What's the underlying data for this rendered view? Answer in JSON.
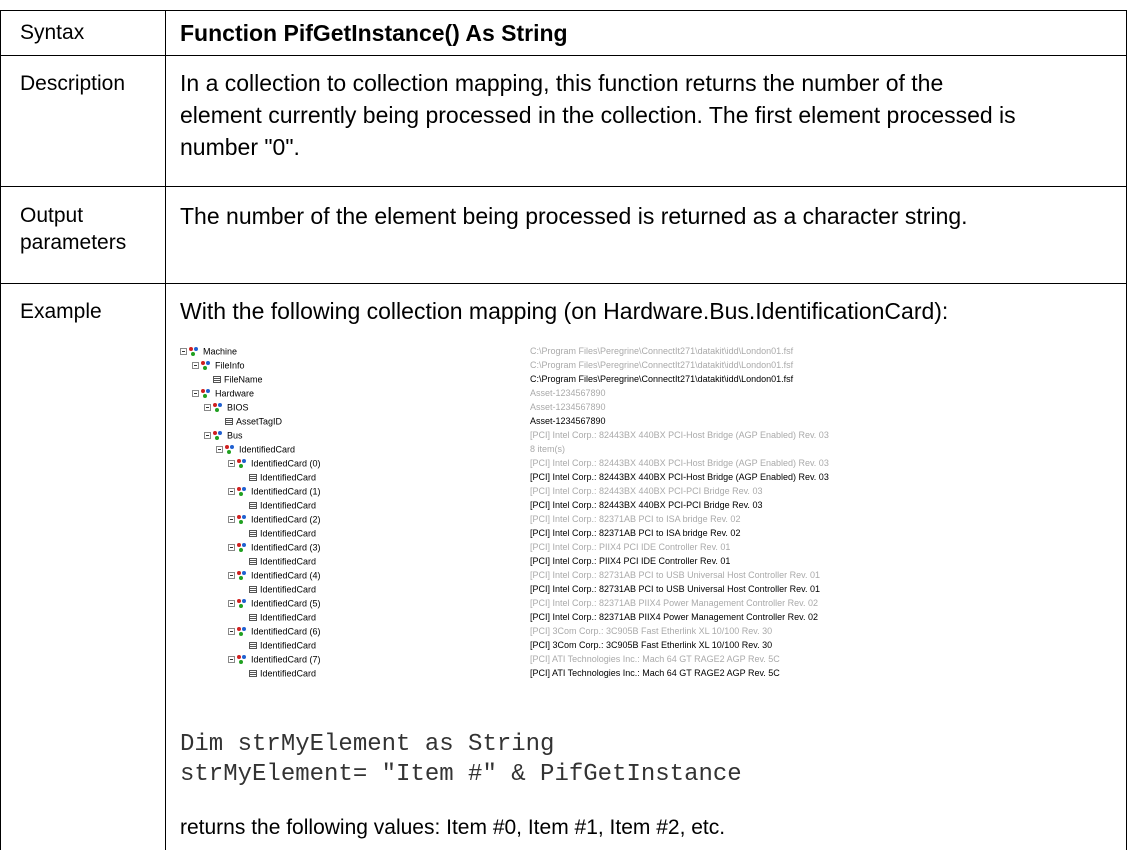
{
  "rows": {
    "syntax": {
      "label": "Syntax",
      "value": "Function PifGetInstance() As String"
    },
    "description": {
      "label": "Description",
      "lines": [
        "In a collection to collection mapping, this function returns the number of the",
        "element currently being processed in the collection. The first element processed is",
        "number \"0\"."
      ]
    },
    "output": {
      "label_lines": [
        "Output",
        "parameters"
      ],
      "value": "The number of the element being processed is returned as a character string."
    },
    "example": {
      "label": "Example",
      "intro": "With the following collection mapping (on Hardware.Bus.IdentificationCard):",
      "code_lines": [
        "Dim strMyElement as String",
        "strMyElement= \"Item #\" & PifGetInstance"
      ],
      "result": "returns the following values: Item #0, Item #1, Item #2, etc."
    }
  },
  "tree": [
    {
      "depth": 0,
      "icon": "collection",
      "label": "Machine",
      "value": "C:\\Program Files\\Peregrine\\ConnectIt271\\datakit\\idd\\London01.fsf",
      "dim": true
    },
    {
      "depth": 1,
      "icon": "collection",
      "label": "FileInfo",
      "value": "C:\\Program Files\\Peregrine\\ConnectIt271\\datakit\\idd\\London01.fsf",
      "dim": true
    },
    {
      "depth": 2,
      "icon": "field",
      "label": "FileName",
      "value": "C:\\Program Files\\Peregrine\\ConnectIt271\\datakit\\idd\\London01.fsf",
      "dim": false
    },
    {
      "depth": 1,
      "icon": "collection",
      "label": "Hardware",
      "value": "Asset-1234567890",
      "dim": true
    },
    {
      "depth": 2,
      "icon": "collection",
      "label": "BIOS",
      "value": "Asset-1234567890",
      "dim": true
    },
    {
      "depth": 3,
      "icon": "field",
      "label": "AssetTagID",
      "value": "Asset-1234567890",
      "dim": false
    },
    {
      "depth": 2,
      "icon": "collection",
      "label": "Bus",
      "value": "[PCI] Intel Corp.: 82443BX 440BX PCI-Host Bridge (AGP Enabled) Rev. 03",
      "dim": true
    },
    {
      "depth": 3,
      "icon": "collection",
      "label": "IdentifiedCard",
      "value": "8 item(s)",
      "dim": true
    },
    {
      "depth": 4,
      "icon": "collection",
      "label": "IdentifiedCard (0)",
      "value": "[PCI] Intel Corp.: 82443BX 440BX PCI-Host Bridge (AGP Enabled) Rev. 03",
      "dim": true
    },
    {
      "depth": 5,
      "icon": "field",
      "label": "IdentifiedCard",
      "value": "[PCI] Intel Corp.: 82443BX 440BX PCI-Host Bridge (AGP Enabled) Rev. 03",
      "dim": false
    },
    {
      "depth": 4,
      "icon": "collection",
      "label": "IdentifiedCard (1)",
      "value": "[PCI] Intel Corp.: 82443BX 440BX PCI-PCI Bridge Rev. 03",
      "dim": true
    },
    {
      "depth": 5,
      "icon": "field",
      "label": "IdentifiedCard",
      "value": "[PCI] Intel Corp.: 82443BX 440BX PCI-PCI Bridge Rev. 03",
      "dim": false
    },
    {
      "depth": 4,
      "icon": "collection",
      "label": "IdentifiedCard (2)",
      "value": "[PCI] Intel Corp.: 82371AB PCI to ISA bridge Rev. 02",
      "dim": true
    },
    {
      "depth": 5,
      "icon": "field",
      "label": "IdentifiedCard",
      "value": "[PCI] Intel Corp.: 82371AB PCI to ISA bridge Rev. 02",
      "dim": false
    },
    {
      "depth": 4,
      "icon": "collection",
      "label": "IdentifiedCard (3)",
      "value": "[PCI] Intel Corp.: PIIX4 PCI IDE Controller Rev. 01",
      "dim": true
    },
    {
      "depth": 5,
      "icon": "field",
      "label": "IdentifiedCard",
      "value": "[PCI] Intel Corp.: PIIX4 PCI IDE Controller Rev. 01",
      "dim": false
    },
    {
      "depth": 4,
      "icon": "collection",
      "label": "IdentifiedCard (4)",
      "value": "[PCI] Intel Corp.: 82731AB PCI to USB Universal Host Controller Rev. 01",
      "dim": true
    },
    {
      "depth": 5,
      "icon": "field",
      "label": "IdentifiedCard",
      "value": "[PCI] Intel Corp.: 82731AB PCI to USB Universal Host Controller Rev. 01",
      "dim": false
    },
    {
      "depth": 4,
      "icon": "collection",
      "label": "IdentifiedCard (5)",
      "value": "[PCI] Intel Corp.: 82371AB PIIX4 Power Management Controller Rev. 02",
      "dim": true
    },
    {
      "depth": 5,
      "icon": "field",
      "label": "IdentifiedCard",
      "value": "[PCI] Intel Corp.: 82371AB PIIX4 Power Management Controller Rev. 02",
      "dim": false
    },
    {
      "depth": 4,
      "icon": "collection",
      "label": "IdentifiedCard (6)",
      "value": "[PCI] 3Com Corp.: 3C905B Fast Etherlink XL 10/100 Rev. 30",
      "dim": true
    },
    {
      "depth": 5,
      "icon": "field",
      "label": "IdentifiedCard",
      "value": "[PCI] 3Com Corp.: 3C905B Fast Etherlink XL 10/100 Rev. 30",
      "dim": false
    },
    {
      "depth": 4,
      "icon": "collection",
      "label": "IdentifiedCard (7)",
      "value": "[PCI] ATI Technologies Inc.: Mach 64 GT RAGE2 AGP Rev. 5C",
      "dim": true
    },
    {
      "depth": 5,
      "icon": "field",
      "label": "IdentifiedCard",
      "value": "[PCI] ATI Technologies Inc.: Mach 64 GT RAGE2 AGP Rev. 5C",
      "dim": false
    }
  ]
}
